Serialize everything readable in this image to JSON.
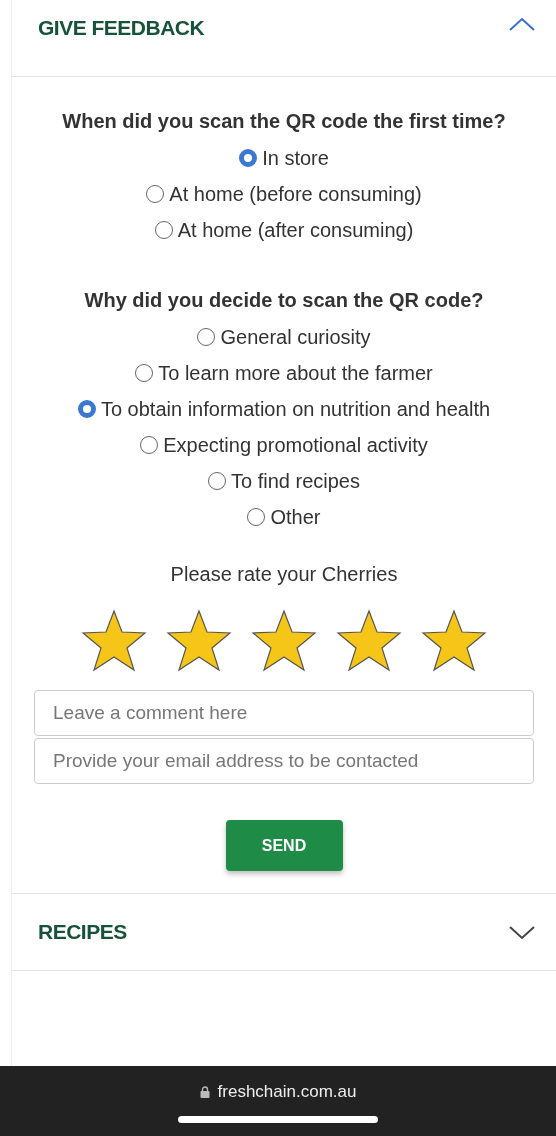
{
  "sections": [
    {
      "title": "GIVE FEEDBACK",
      "expanded": true
    },
    {
      "title": "RECIPES",
      "expanded": false
    }
  ],
  "questions": [
    {
      "text": "When did you scan the QR code the first time?",
      "options": [
        {
          "label": "In store",
          "selected": true
        },
        {
          "label": "At home (before consuming)",
          "selected": false
        },
        {
          "label": "At home (after consuming)",
          "selected": false
        }
      ]
    },
    {
      "text": "Why did you decide to scan the QR code?",
      "options": [
        {
          "label": "General curiosity",
          "selected": false
        },
        {
          "label": "To learn more about the farmer",
          "selected": false
        },
        {
          "label": "To obtain information on nutrition and health",
          "selected": true
        },
        {
          "label": "Expecting promotional activity",
          "selected": false
        },
        {
          "label": "To find recipes",
          "selected": false
        },
        {
          "label": "Other",
          "selected": false
        }
      ]
    }
  ],
  "rating": {
    "prompt": "Please rate your Cherries",
    "stars": 5
  },
  "fields": [
    {
      "placeholder": "Leave a comment here"
    },
    {
      "placeholder": "Provide your email address to be contacted"
    }
  ],
  "send_button": "SEND",
  "browser_bar": {
    "url": "freshchain.com.au"
  }
}
